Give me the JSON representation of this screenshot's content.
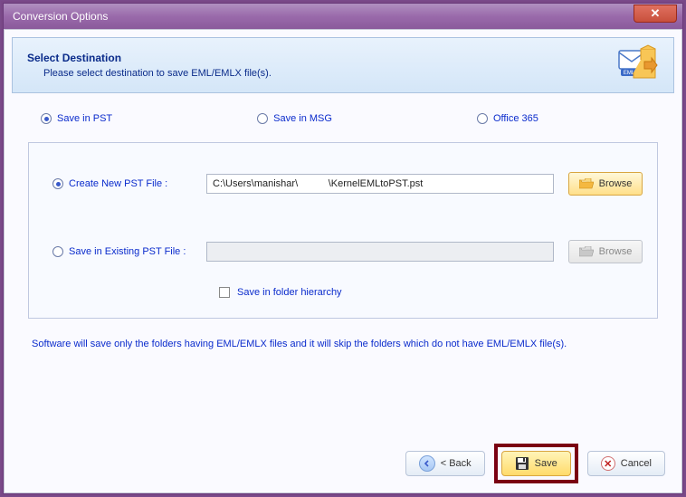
{
  "window": {
    "title": "Conversion Options"
  },
  "header": {
    "title": "Select Destination",
    "subtitle": "Please select destination to save EML/EMLX file(s)."
  },
  "saveFormat": {
    "pst": "Save in PST",
    "msg": "Save in MSG",
    "o365": "Office 365"
  },
  "main": {
    "createNew": {
      "label": "Create New PST File :",
      "value": "C:\\Users\\manishar\\           \\KernelEMLtoPST.pst"
    },
    "existing": {
      "label": "Save in Existing PST File :",
      "value": ""
    },
    "browse": "Browse",
    "hierarchy": "Save in folder hierarchy"
  },
  "note": "Software will save only the folders having EML/EMLX files and it will skip the folders which do not have EML/EMLX file(s).",
  "footer": {
    "back": "< Back",
    "save": "Save",
    "cancel": "Cancel"
  }
}
